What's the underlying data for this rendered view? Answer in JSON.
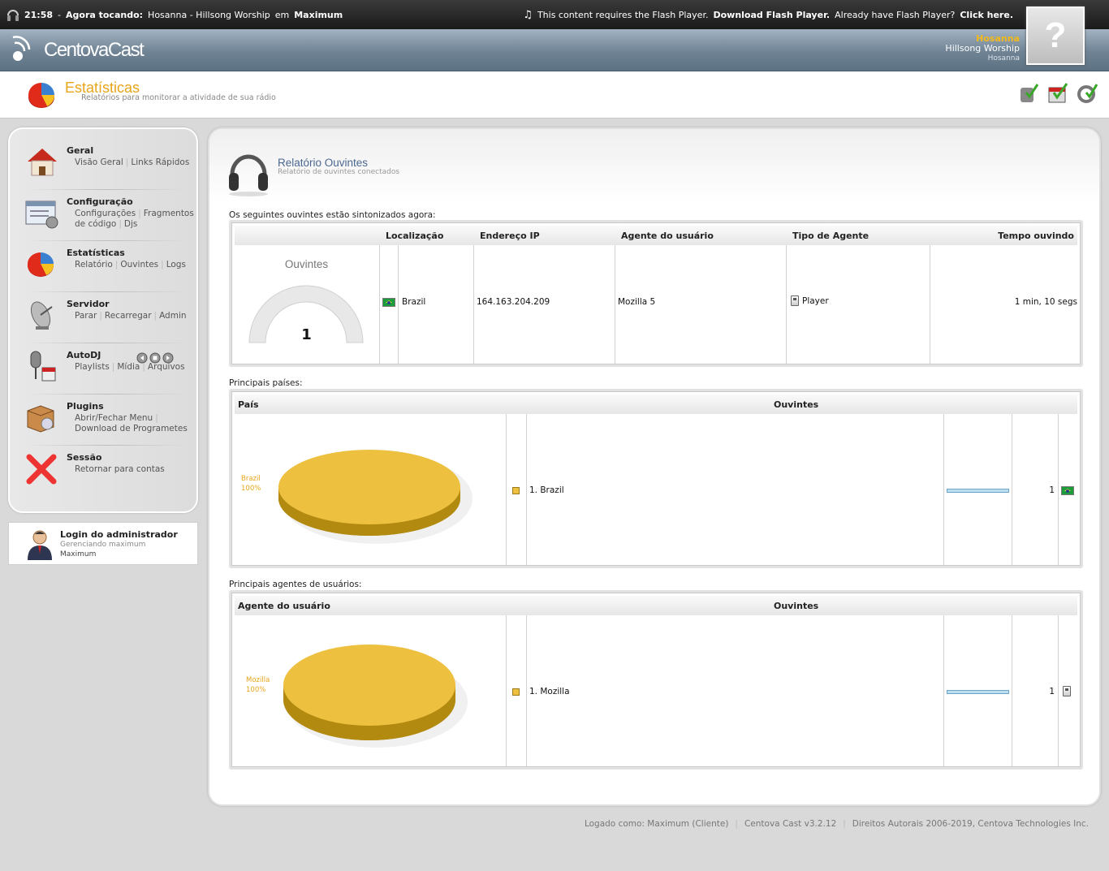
{
  "topbar": {
    "time": "21:58",
    "now_playing_label": "Agora tocando:",
    "track": "Hosanna - Hillsong Worship",
    "em": "em",
    "station": "Maximum",
    "flash_msg": "This content requires the Flash Player.",
    "flash_download": "Download Flash Player.",
    "flash_have": "Already have Flash Player?",
    "flash_click": "Click here."
  },
  "header": {
    "logo_text": "CentovaCast",
    "track_title": "Hosanna",
    "track_artist": "Hillsong Worship",
    "track_album": "Hosanna",
    "album_art_placeholder": "?"
  },
  "page": {
    "title": "Estatísticas",
    "subtitle": "Relatórios para monitorar a atividade de sua rádio"
  },
  "sidebar": {
    "items": [
      {
        "title": "Geral",
        "links": [
          "Visão Geral",
          "Links Rápidos"
        ]
      },
      {
        "title": "Configuração",
        "links": [
          "Configurações",
          "Fragmentos de código",
          "Djs"
        ]
      },
      {
        "title": "Estatísticas",
        "links": [
          "Relatório",
          "Ouvintes",
          "Logs"
        ]
      },
      {
        "title": "Servidor",
        "links": [
          "Parar",
          "Recarregar",
          "Admin"
        ]
      },
      {
        "title": "AutoDJ",
        "links": [
          "Playlists",
          "Mídia",
          "Arquivos"
        ]
      },
      {
        "title": "Plugins",
        "links": [
          "Abrir/Fechar Menu",
          "Download de Programetes"
        ]
      },
      {
        "title": "Sessão",
        "links": [
          "Retornar para contas"
        ]
      }
    ]
  },
  "login": {
    "title": "Login do administrador",
    "managing": "Gerenciando maximum",
    "user": "Maximum"
  },
  "main": {
    "title": "Relatório Ouvintes",
    "subtitle": "Relatório de ouvintes conectados",
    "listeners_caption": "Os seguintes ouvintes estão sintonizados agora:",
    "listeners_headers": [
      "Localização",
      "Endereço IP",
      "Agente do usuário",
      "Tipo de Agente",
      "Tempo ouvindo"
    ],
    "gauge_label": "Ouvintes",
    "gauge_value": 1,
    "listeners": [
      {
        "location": "Brazil",
        "ip": "164.163.204.209",
        "agent": "Mozilla 5",
        "agent_type": "Player",
        "time": "1 min, 10 segs"
      }
    ],
    "countries_caption": "Principais países:",
    "countries_headers": [
      "País",
      "Ouvintes"
    ],
    "countries_pie_label": "Brazil",
    "countries_pie_pct": "100%",
    "countries": [
      {
        "name": "1. Brazil",
        "count": "1",
        "share": 1.0
      }
    ],
    "agents_caption": "Principais agentes de usuários:",
    "agents_headers": [
      "Agente do usuário",
      "Ouvintes"
    ],
    "agents_pie_label": "Mozilla",
    "agents_pie_pct": "100%",
    "agents": [
      {
        "name": "1. Mozilla",
        "count": "1",
        "share": 1.0
      }
    ]
  },
  "footer": {
    "logged_as": "Logado como: Maximum (Cliente)",
    "version": "Centova Cast v3.2.12",
    "copyright": "Direitos Autorais 2006-2019, Centova Technologies Inc."
  },
  "colors": {
    "accent": "#e8a51a",
    "pie": "#eec040",
    "pie_side": "#b38a10",
    "link_title": "#4a6791"
  }
}
